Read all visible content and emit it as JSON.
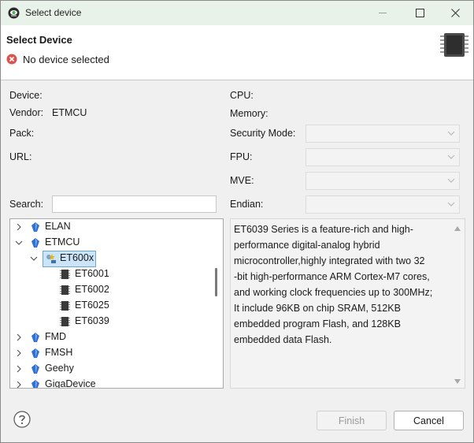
{
  "window": {
    "title": "Select device"
  },
  "header": {
    "title": "Select Device",
    "status_message": "No device selected"
  },
  "info": {
    "device_label": "Device:",
    "vendor_label": "Vendor:",
    "vendor_value": "ETMCU",
    "pack_label": "Pack:",
    "url_label": "URL:",
    "cpu_label": "CPU:",
    "memory_label": "Memory:",
    "security_mode_label": "Security Mode:",
    "fpu_label": "FPU:",
    "mve_label": "MVE:",
    "endian_label": "Endian:"
  },
  "search": {
    "label": "Search:",
    "value": ""
  },
  "tree": {
    "vendors": [
      {
        "label": "ELAN",
        "expanded": false
      },
      {
        "label": "ETMCU",
        "expanded": true
      },
      {
        "label": "ET600x",
        "expanded": true,
        "selected": true,
        "child": true
      },
      {
        "label": "ET6001",
        "device": true
      },
      {
        "label": "ET6002",
        "device": true
      },
      {
        "label": "ET6025",
        "device": true
      },
      {
        "label": "ET6039",
        "device": true
      },
      {
        "label": "FMD",
        "expanded": false
      },
      {
        "label": "FMSH",
        "expanded": false
      },
      {
        "label": "Geehy",
        "expanded": false
      },
      {
        "label": "GigaDevice",
        "expanded": false
      }
    ]
  },
  "description": {
    "text": "ET6039 Series is a feature-rich and high-\nperformance digital-analog hybrid\nmicrocontroller,highly integrated with two 32\n-bit high-performance ARM Cortex-M7 cores,\nand working clock frequencies up to 300MHz;\nIt include 96KB on chip SRAM, 512KB\nembedded program Flash, and 128KB\nembedded data Flash."
  },
  "footer": {
    "finish_label": "Finish",
    "cancel_label": "Cancel"
  },
  "colors": {
    "titlebar": "#e8f2e8",
    "selection": "#cce4f7",
    "error": "#d9534f",
    "vendor_icon": "#2f6fd6"
  },
  "icons": [
    "app-icon",
    "error-icon",
    "chip-icon",
    "chevron-down-icon",
    "chevron-right-icon",
    "vendor-icon",
    "family-icon",
    "device-chip-icon",
    "help-icon"
  ]
}
